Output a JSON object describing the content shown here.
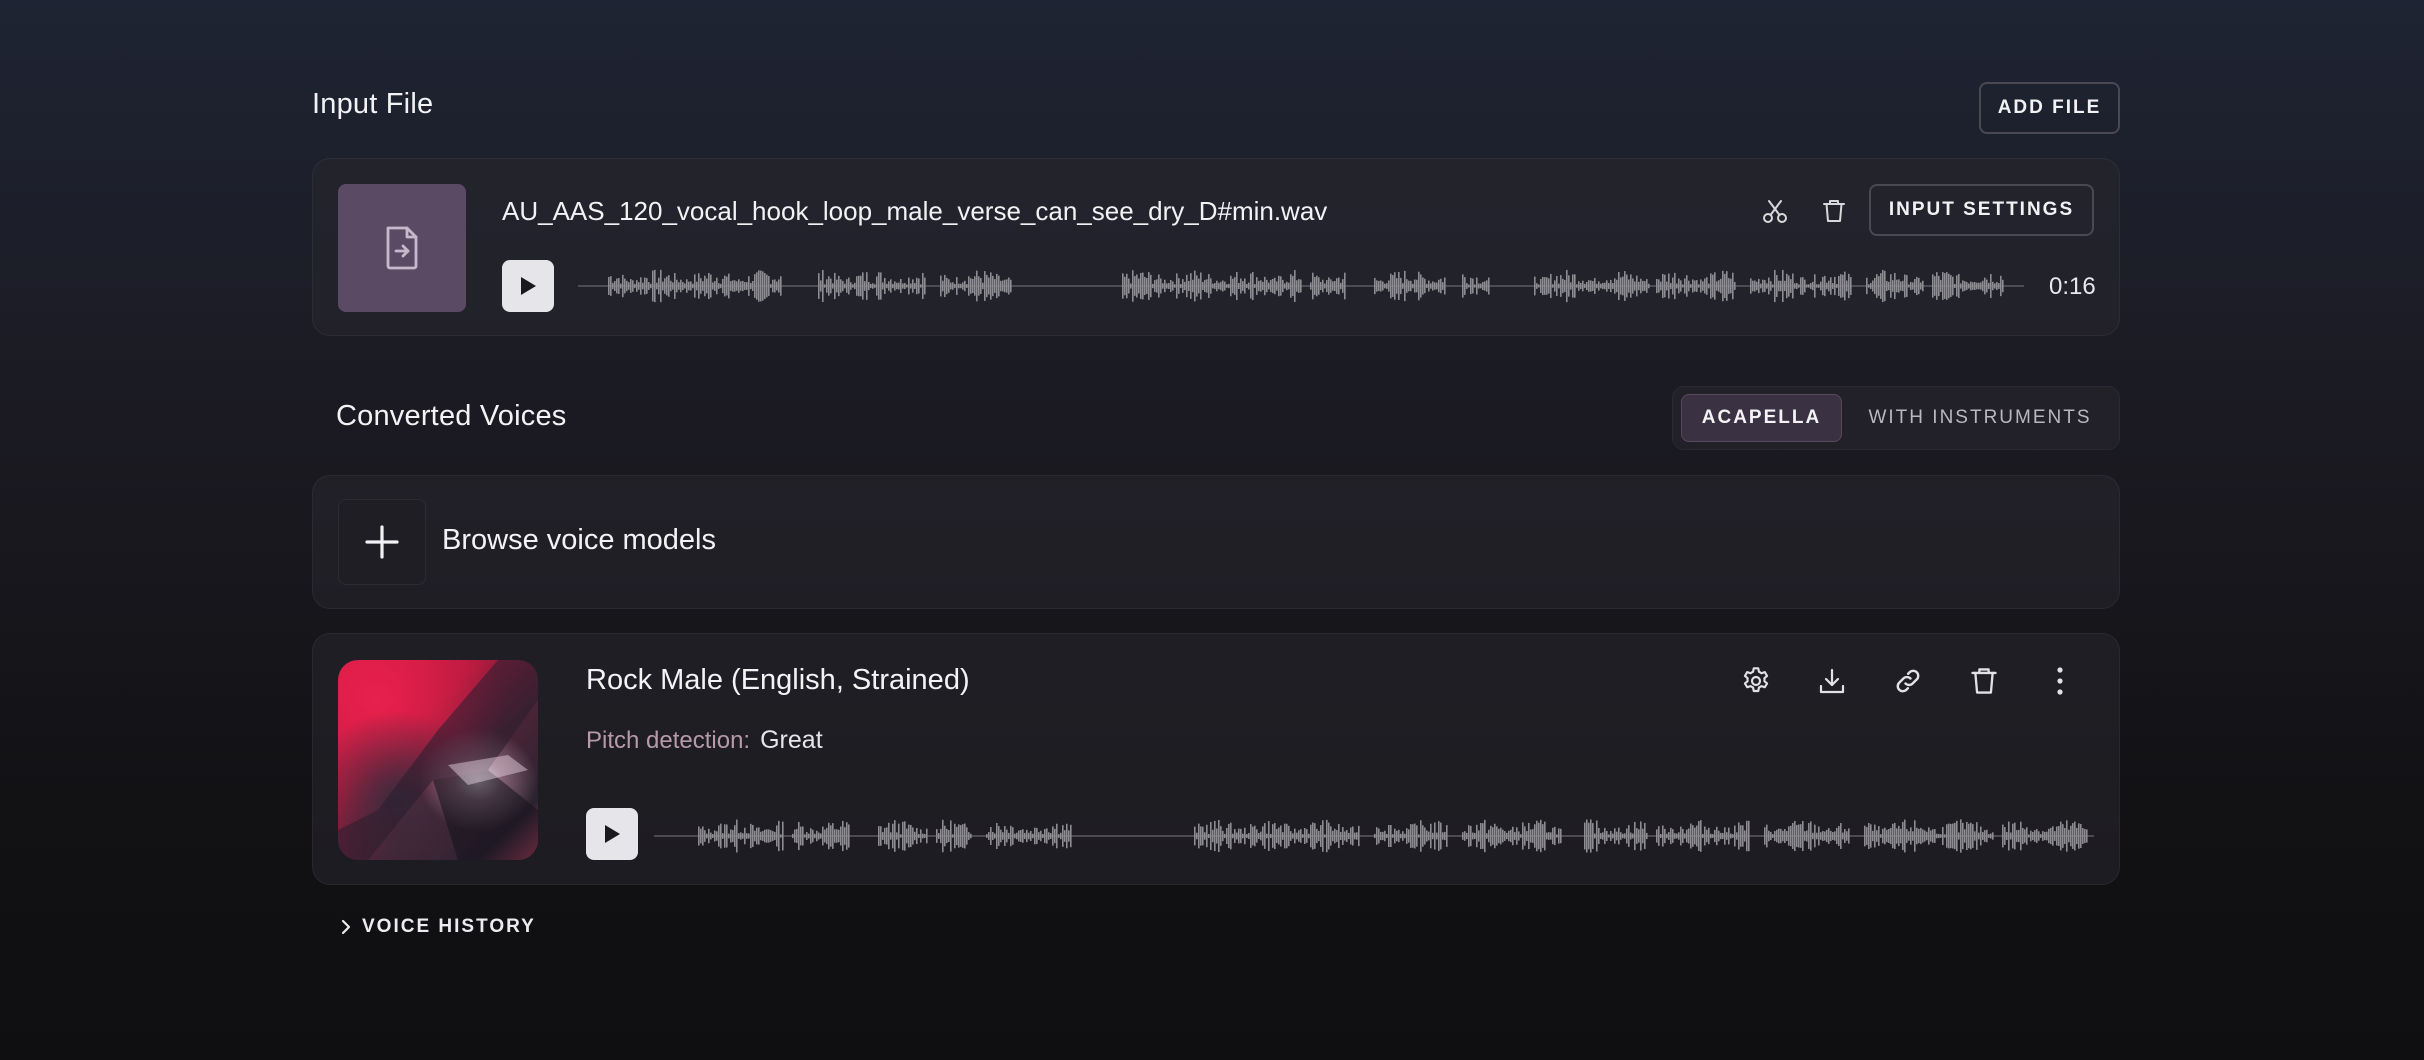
{
  "input_section": {
    "title": "Input File",
    "add_file_label": "ADD FILE"
  },
  "input_file": {
    "filename": "AU_AAS_120_vocal_hook_loop_male_verse_can_see_dry_D#min.wav",
    "duration": "0:16",
    "settings_label": "INPUT SETTINGS",
    "icons": [
      "file-import-icon",
      "scissors-icon",
      "trash-icon",
      "play-icon"
    ]
  },
  "converted_section": {
    "title": "Converted Voices",
    "tabs": [
      {
        "label": "ACAPELLA",
        "active": true
      },
      {
        "label": "WITH INSTRUMENTS",
        "active": false
      }
    ]
  },
  "browse": {
    "label": "Browse voice models",
    "icon": "plus-icon"
  },
  "voice": {
    "name": "Rock Male (English, Strained)",
    "pitch_label": "Pitch detection:",
    "pitch_value": "Great",
    "icons": [
      "gear-icon",
      "download-icon",
      "link-icon",
      "trash-icon",
      "more-vertical-icon",
      "play-icon"
    ]
  },
  "history": {
    "label": "VOICE HISTORY",
    "icon": "chevron-right-icon"
  },
  "colors": {
    "waveform": "#8c8c91",
    "waveform_line": "#5b5b61",
    "accent_tab": "#3a3142",
    "thumb": "#5a4a64"
  }
}
